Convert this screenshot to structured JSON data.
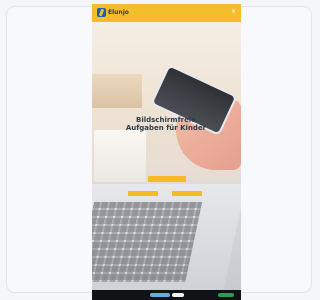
{
  "app": {
    "logo_text": "Elunjo",
    "logo_icon": "brand-mark-icon"
  },
  "hero": {
    "headline": "Bildschirmfreie Aufgaben für Kinder",
    "subline": "",
    "primary_button": "",
    "secondary_buttons": [
      "",
      ""
    ],
    "link_text": ""
  },
  "colors": {
    "accent": "#f3bd2b",
    "logo": "#1d5fae",
    "bottom": "#101315",
    "bottom_left": "#6ea8df",
    "bottom_right": "#2d9b52"
  }
}
